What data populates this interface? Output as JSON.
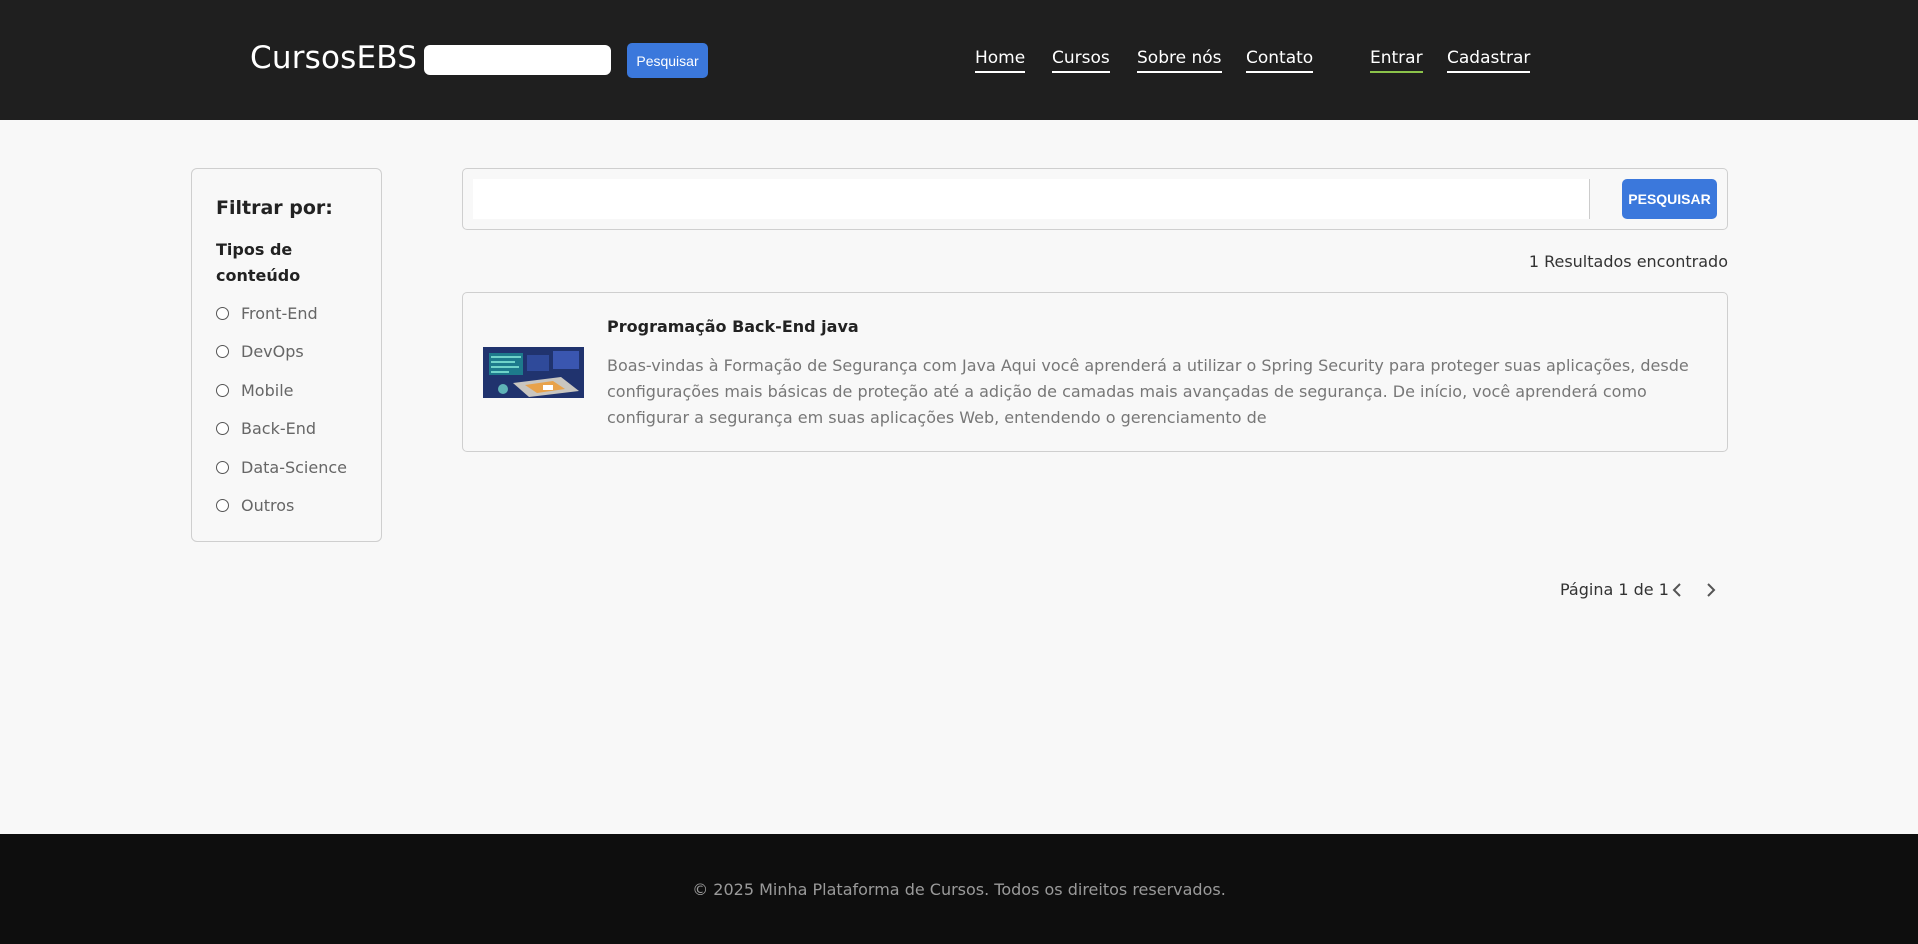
{
  "header": {
    "brand": "CursosEBS",
    "search_placeholder": "",
    "search_button": "Pesquisar",
    "nav": [
      {
        "label": "Home"
      },
      {
        "label": "Cursos"
      },
      {
        "label": "Sobre nós"
      },
      {
        "label": "Contato"
      }
    ],
    "auth": [
      {
        "label": "Entrar",
        "active": true
      },
      {
        "label": "Cadastrar",
        "active": false
      }
    ]
  },
  "sidebar": {
    "title": "Filtrar por:",
    "subtitle": "Tipos de conteúdo",
    "options": [
      {
        "label": "Front-End"
      },
      {
        "label": "DevOps"
      },
      {
        "label": "Mobile"
      },
      {
        "label": "Back-End"
      },
      {
        "label": "Data-Science"
      },
      {
        "label": "Outros"
      }
    ]
  },
  "search": {
    "placeholder": "",
    "button": "PESQUISAR"
  },
  "results": {
    "count_text": "1 Resultados encontrado",
    "items": [
      {
        "title": "Programação Back-End java",
        "description": "Boas-vindas à Formação de Segurança com Java Aqui você aprenderá a utilizar o Spring Security para proteger suas aplicações, desde configurações mais básicas de proteção até a adição de camadas mais avançadas de segurança. De início, você aprenderá como configurar a segurança em suas aplicações Web, entendendo o gerenciamento de"
      }
    ]
  },
  "pagination": {
    "text": "Página 1 de 1",
    "prev_icon": "chevron-left-icon",
    "next_icon": "chevron-right-icon"
  },
  "footer": {
    "text": "© 2025 Minha Plataforma de Cursos. Todos os direitos reservados."
  },
  "colors": {
    "header_bg": "#1f1f1f",
    "accent_blue": "#3b78dc",
    "active_underline": "#8bc34a",
    "footer_bg": "#0e0e0e",
    "page_bg": "#f8f8f8"
  }
}
